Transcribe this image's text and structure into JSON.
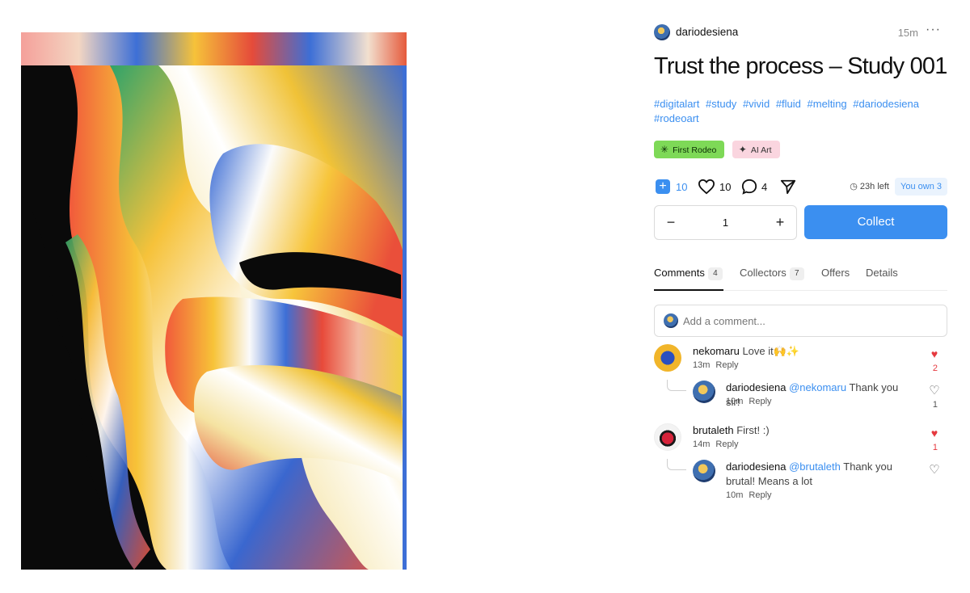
{
  "post": {
    "author": "dariodesiena",
    "time": "15m",
    "more": "···",
    "title": "Trust the process – Study 001",
    "tags": [
      "#digitalart",
      "#study",
      "#vivid",
      "#fluid",
      "#melting",
      "#dariodesiena",
      "#rodeoart"
    ],
    "badges": [
      {
        "label": "First Rodeo",
        "icon": "rodeo-star-icon",
        "color": "#7ed957"
      },
      {
        "label": "AI Art",
        "icon": "sparkle-icon",
        "color": "#fad5df"
      }
    ]
  },
  "actions": {
    "collect_count": "10",
    "likes": "10",
    "comments": "4",
    "time_left": "23h left",
    "owned": "You own 3"
  },
  "purchase": {
    "quantity": "1",
    "minus": "−",
    "plus": "+",
    "collect_label": "Collect"
  },
  "tabs": [
    {
      "label": "Comments",
      "count": "4",
      "active": true
    },
    {
      "label": "Collectors",
      "count": "7"
    },
    {
      "label": "Offers"
    },
    {
      "label": "Details"
    }
  ],
  "comment_input": {
    "placeholder": "Add a comment..."
  },
  "comments": [
    {
      "author": "nekomaru",
      "text": "Love it🙌✨",
      "time": "13m",
      "reply": "Reply",
      "likes": "2",
      "liked": true,
      "replies": [
        {
          "author": "dariodesiena",
          "mention": "@nekomaru",
          "text": "Thank you sir!",
          "time": "10m",
          "reply": "Reply",
          "likes": "1",
          "liked": false
        }
      ]
    },
    {
      "author": "brutaleth",
      "text": "First! :)",
      "time": "14m",
      "reply": "Reply",
      "likes": "1",
      "liked": true,
      "replies": [
        {
          "author": "dariodesiena",
          "mention": "@brutaleth",
          "text": "Thank you brutal! Means a lot",
          "time": "10m",
          "reply": "Reply",
          "likes": "",
          "liked": false
        }
      ]
    }
  ],
  "colors": {
    "accent": "#3b8ff0",
    "like": "#e5393f",
    "badge_green": "#7ed957",
    "badge_pink": "#fad5df"
  }
}
